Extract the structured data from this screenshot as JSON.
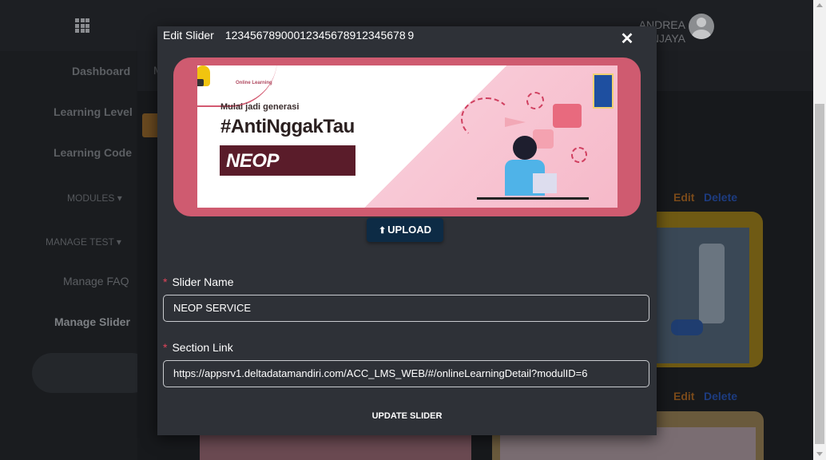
{
  "topbar": {
    "user_name": "ANDREA REGINA NJAYA"
  },
  "sidebar": {
    "items": [
      {
        "label": "Dashboard"
      },
      {
        "label": "Learning Level"
      },
      {
        "label": "Learning Code"
      },
      {
        "label": "MODULES"
      },
      {
        "label": "MANAGE TEST"
      },
      {
        "label": "Manage FAQ"
      },
      {
        "label": "Manage Slider"
      }
    ],
    "active": "Manage Slider"
  },
  "main": {
    "tab_partial": "M"
  },
  "cards": [
    {
      "edit_label": "Edit",
      "delete_label": "Delete"
    },
    {
      "edit_label": "Edit",
      "delete_label": "Delete"
    }
  ],
  "modal": {
    "title": "Edit Slider",
    "slider_id": "12345678900012345678912345678 9",
    "close_icon": "close-icon",
    "banner": {
      "logo_text": "Online Learning",
      "subtitle": "Mulai jadi generasi",
      "hashtag": "#AntiNggakTau",
      "box_text": "NEOP SERVICE"
    },
    "upload_label": "UPLOAD",
    "slider_name": {
      "label": "Slider Name",
      "required_mark": "*",
      "value": "NEOP SERVICE"
    },
    "section_link": {
      "label": "Section Link",
      "required_mark": "*",
      "value": "https://appsrv1.deltadatamandiri.com/ACC_LMS_WEB/#/onlineLearningDetail?modulID=6"
    },
    "update_label": "UPDATE SLIDER"
  },
  "colors": {
    "modal_bg": "#2e3137",
    "upload_btn": "#0d2b45",
    "required": "#e0455a",
    "banner_pink": "#cf5b70"
  }
}
